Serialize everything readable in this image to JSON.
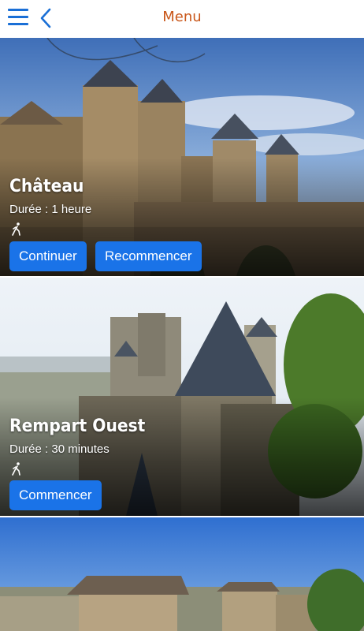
{
  "header": {
    "title": "Menu",
    "menu_icon": "hamburger-menu-icon",
    "back_icon": "chevron-left-icon"
  },
  "colors": {
    "accent_blue": "#1a73e8",
    "title_orange": "#c9571a"
  },
  "cards": [
    {
      "title": "Château",
      "duration": "Durée : 1 heure",
      "icon": "walking-person-icon",
      "buttons": [
        "Continuer",
        "Recommencer"
      ]
    },
    {
      "title": "Rempart Ouest",
      "duration": "Durée : 30 minutes",
      "icon": "walking-person-icon",
      "buttons": [
        "Commencer"
      ]
    },
    {
      "title": "",
      "duration": "",
      "buttons": []
    }
  ]
}
